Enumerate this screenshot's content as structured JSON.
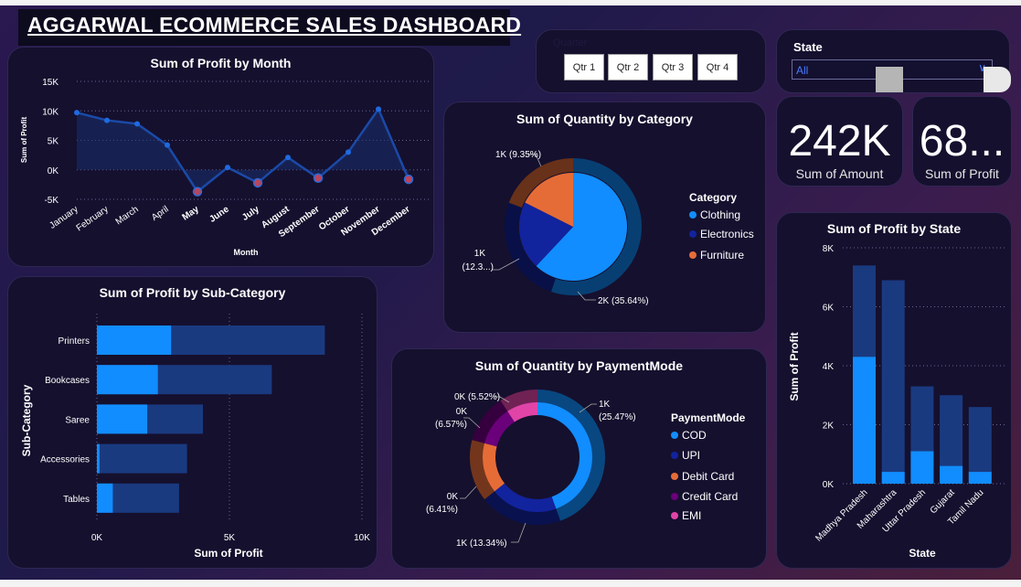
{
  "dashboard": {
    "title": "AGGARWAL ECOMMERCE SALES DASHBOARD"
  },
  "slicer_qtr": {
    "label": "Quarter",
    "buttons": [
      "Qtr 1",
      "Qtr 2",
      "Qtr 3",
      "Qtr 4"
    ]
  },
  "slicer_state": {
    "label": "State",
    "value": "All"
  },
  "kpi": {
    "amount_value": "242K",
    "amount_label": "Sum of Amount",
    "profit_value": "68...",
    "profit_label": "Sum of Profit"
  },
  "colors": {
    "bright_blue": "#118dff",
    "navy": "#1a3a80",
    "dark_blue": "#12239e",
    "orange": "#e66c37",
    "purple": "#6b007b",
    "pink": "#e044a7",
    "marker": "#b7455e"
  },
  "chart_data": [
    {
      "id": "profit_by_month",
      "type": "area",
      "title": "Sum of Profit by Month",
      "xlabel": "Month",
      "ylabel": "Sum of Profit",
      "ylim": [
        -5000,
        15000
      ],
      "yticks": [
        "15K",
        "10K",
        "5K",
        "0K",
        "-5K"
      ],
      "ytick_values": [
        15000,
        10000,
        5000,
        0,
        -5000
      ],
      "categories": [
        "January",
        "February",
        "March",
        "April",
        "May",
        "June",
        "July",
        "August",
        "September",
        "October",
        "November",
        "December"
      ],
      "values": [
        9700,
        8400,
        7800,
        4200,
        -3700,
        400,
        -2200,
        2100,
        -1400,
        3000,
        10300,
        -1600
      ],
      "grid": true
    },
    {
      "id": "profit_by_subcategory",
      "type": "bar",
      "title": "Sum of Profit by Sub-Category",
      "xlabel": "Sum of Profit",
      "ylabel": "Sub-Category",
      "xlim": [
        0,
        10000
      ],
      "xticks": [
        "0K",
        "5K",
        "10K"
      ],
      "xtick_values": [
        0,
        5000,
        10000
      ],
      "categories": [
        "Printers",
        "Bookcases",
        "Saree",
        "Accessories",
        "Tables"
      ],
      "total_values": [
        8600,
        6600,
        4000,
        3400,
        3100
      ],
      "highlight_values": [
        2800,
        2300,
        1900,
        100,
        600
      ]
    },
    {
      "id": "qty_by_category",
      "type": "pie",
      "title": "Sum of Quantity by Category",
      "legend_title": "Category",
      "labels": [
        "Clothing",
        "Electronics",
        "Furniture"
      ],
      "values": [
        62.0,
        20.4,
        17.6
      ],
      "outer_values": [
        55.2,
        25.5,
        19.3
      ],
      "data_labels": [
        "2K (35.64%)",
        "1K (12.3...)",
        "1K (9.35%)"
      ],
      "colors": [
        "#118dff",
        "#12239e",
        "#e66c37"
      ],
      "legend": "right"
    },
    {
      "id": "qty_by_paymentmode",
      "type": "pie",
      "title": "Sum of Quantity by PaymentMode",
      "legend_title": "PaymentMode",
      "labels": [
        "COD",
        "UPI",
        "Debit Card",
        "Credit Card",
        "EMI"
      ],
      "values": [
        44.5,
        19.8,
        14.8,
        11.7,
        9.2
      ],
      "data_labels": [
        "1K (25.47%)",
        "1K (13.34%)",
        "0K (6.41%)",
        "0K (6.57%)",
        "0K (5.52%)"
      ],
      "colors": [
        "#118dff",
        "#12239e",
        "#e66c37",
        "#6b007b",
        "#e044a7"
      ],
      "legend": "right"
    },
    {
      "id": "profit_by_state",
      "type": "bar",
      "title": "Sum of Profit by State",
      "xlabel": "State",
      "ylabel": "Sum of Profit",
      "ylim": [
        0,
        8000
      ],
      "yticks": [
        "8K",
        "6K",
        "4K",
        "2K",
        "0K"
      ],
      "ytick_values": [
        8000,
        6000,
        4000,
        2000,
        0
      ],
      "categories": [
        "Madhya Pradesh",
        "Maharashtra",
        "Uttar Pradesh",
        "Gujarat",
        "Tamil Nadu"
      ],
      "total_values": [
        7400,
        6900,
        3300,
        3000,
        2600
      ],
      "highlight_values": [
        4300,
        400,
        1100,
        600,
        400
      ]
    }
  ]
}
